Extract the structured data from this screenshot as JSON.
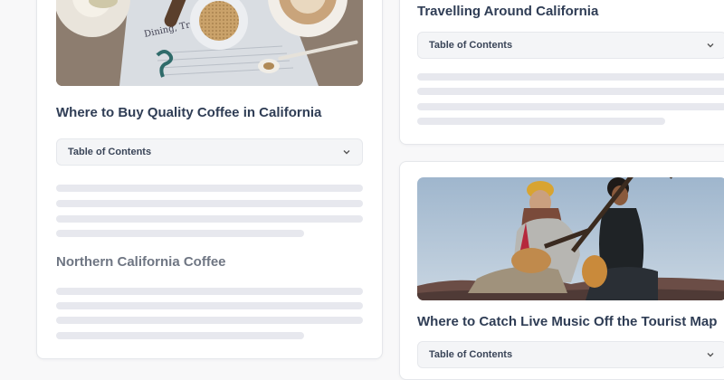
{
  "cards": [
    {
      "title": "Where to Buy Quality Coffee in California",
      "toc_label": "Table of Contents",
      "subheading": "Northern California Coffee",
      "image": "coffee-table-photo",
      "newspaper_text": "Dining, Tr"
    },
    {
      "title": "Travelling Around California",
      "toc_label": "Table of Contents"
    },
    {
      "title": "Where to Catch Live Music Off the Tourist Map",
      "toc_label": "Table of Contents",
      "image": "musicians-photo"
    }
  ],
  "colors": {
    "title": "#2f3d55",
    "subheading": "#6f7683",
    "skeleton": "#e7e8ee",
    "toc_bg": "#f4f5f7"
  },
  "icons": {
    "toc_chevron": "chevron-down-icon"
  }
}
